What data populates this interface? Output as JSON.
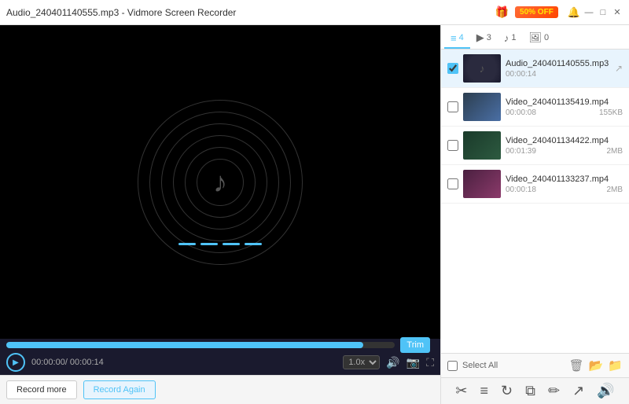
{
  "titleBar": {
    "title": "Audio_240401140555.mp3  -  Vidmore Screen Recorder",
    "promoBadge": "50% OFF",
    "buttons": {
      "minimize": "—",
      "maximize": "□",
      "close": "✕"
    }
  },
  "tabs": [
    {
      "id": "all",
      "icon": "≡",
      "count": "4",
      "active": true
    },
    {
      "id": "video",
      "icon": "▶",
      "count": "3",
      "active": false
    },
    {
      "id": "audio",
      "icon": "♪",
      "count": "1",
      "active": false
    },
    {
      "id": "image",
      "icon": "🖼",
      "count": "0",
      "active": false
    }
  ],
  "files": [
    {
      "name": "Audio_240401140555.mp3",
      "duration": "00:00:14",
      "size": "",
      "type": "audio",
      "checked": true
    },
    {
      "name": "Video_240401135419.mp4",
      "duration": "00:00:08",
      "size": "155KB",
      "type": "video1",
      "checked": false
    },
    {
      "name": "Video_240401134422.mp4",
      "duration": "00:01:39",
      "size": "2MB",
      "type": "video2",
      "checked": false
    },
    {
      "name": "Video_240401133237.mp4",
      "duration": "00:00:18",
      "size": "2MB",
      "type": "video3",
      "checked": false
    }
  ],
  "player": {
    "currentTime": "00:00:00",
    "totalTime": "00:00:14",
    "timeDisplay": "00:00:00/ 00:00:14",
    "speed": "1.0x",
    "trimLabel": "Trim"
  },
  "bottomBar": {
    "recordMore": "Record more",
    "recordAgain": "Record Again",
    "selectAll": "Select All"
  }
}
